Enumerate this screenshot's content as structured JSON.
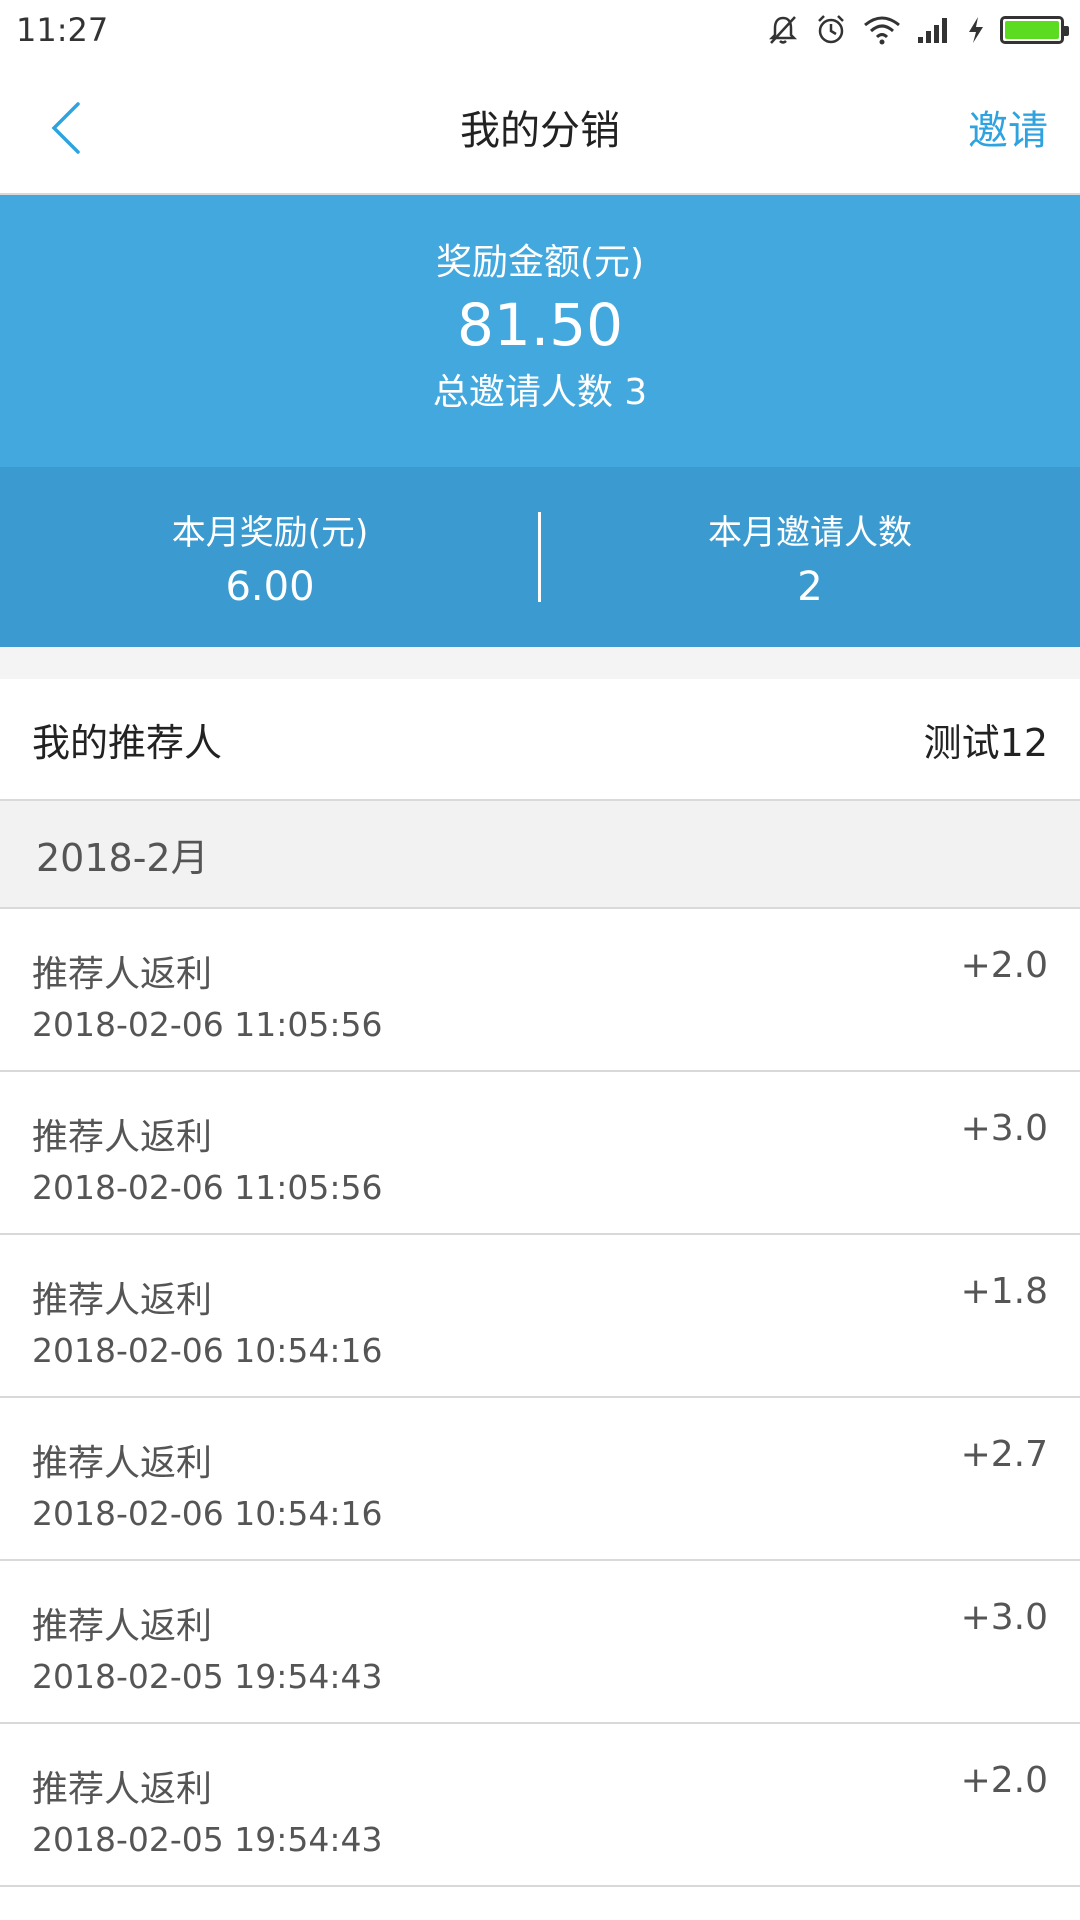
{
  "status_bar": {
    "time": "11:27",
    "icons": [
      "mute-icon",
      "alarm-icon",
      "wifi-icon",
      "signal-icon",
      "charging-icon",
      "battery-icon"
    ],
    "battery_color": "#5cdc21"
  },
  "nav": {
    "title": "我的分销",
    "invite_label": "邀请",
    "accent_color": "#2ea3e0"
  },
  "summary": {
    "reward_label": "奖励金额(元)",
    "reward_amount": "81.50",
    "total_invites": "总邀请人数 3",
    "month_reward_label": "本月奖励(元)",
    "month_reward_value": "6.00",
    "month_invites_label": "本月邀请人数",
    "month_invites_value": "2",
    "primary_color": "#43a8de",
    "secondary_color": "#3b9ad0"
  },
  "referrer": {
    "label": "我的推荐人",
    "value": "测试12"
  },
  "month_group": {
    "label": "2018-2月"
  },
  "records": [
    {
      "title": "推荐人返利",
      "time": "2018-02-06 11:05:56",
      "amount": "+2.0"
    },
    {
      "title": "推荐人返利",
      "time": "2018-02-06 11:05:56",
      "amount": "+3.0"
    },
    {
      "title": "推荐人返利",
      "time": "2018-02-06 10:54:16",
      "amount": "+1.8"
    },
    {
      "title": "推荐人返利",
      "time": "2018-02-06 10:54:16",
      "amount": "+2.7"
    },
    {
      "title": "推荐人返利",
      "time": "2018-02-05 19:54:43",
      "amount": "+3.0"
    },
    {
      "title": "推荐人返利",
      "time": "2018-02-05 19:54:43",
      "amount": "+2.0"
    }
  ]
}
